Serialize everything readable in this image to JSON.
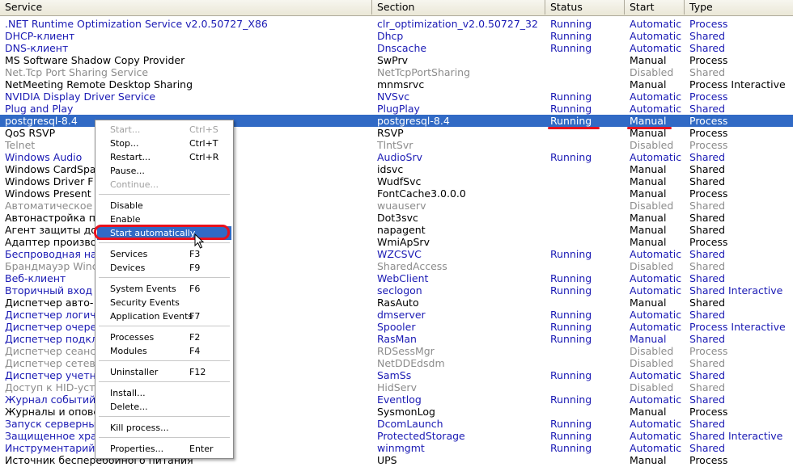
{
  "columns": [
    "Service",
    "Section",
    "Status",
    "Start",
    "Type"
  ],
  "rows": [
    {
      "service": ".NET Runtime Optimization Service v2.0.50727_X86",
      "section": "clr_optimization_v2.0.50727_32",
      "status": "Running",
      "start": "Automatic",
      "type": "Process",
      "style": "blue"
    },
    {
      "service": "DHCP-клиент",
      "section": "Dhcp",
      "status": "Running",
      "start": "Automatic",
      "type": "Shared",
      "style": "blue"
    },
    {
      "service": "DNS-клиент",
      "section": "Dnscache",
      "status": "Running",
      "start": "Automatic",
      "type": "Shared",
      "style": "blue"
    },
    {
      "service": "MS Software Shadow Copy Provider",
      "section": "SwPrv",
      "status": "",
      "start": "Manual",
      "type": "Process",
      "style": "black"
    },
    {
      "service": "Net.Tcp Port Sharing Service",
      "section": "NetTcpPortSharing",
      "status": "",
      "start": "Disabled",
      "type": "Shared",
      "style": "gray"
    },
    {
      "service": "NetMeeting Remote Desktop Sharing",
      "section": "mnmsrvc",
      "status": "",
      "start": "Manual",
      "type": "Process Interactive",
      "style": "black"
    },
    {
      "service": "NVIDIA Display Driver Service",
      "section": "NVSvc",
      "status": "Running",
      "start": "Automatic",
      "type": "Process",
      "style": "blue"
    },
    {
      "service": "Plug and Play",
      "section": "PlugPlay",
      "status": "Running",
      "start": "Automatic",
      "type": "Shared",
      "style": "blue"
    },
    {
      "service": "postgresql-8.4",
      "section": "postgresql-8.4",
      "status": "Running",
      "start": "Manual",
      "type": "Process",
      "style": "sel"
    },
    {
      "service": "QoS RSVP",
      "section": "RSVP",
      "status": "",
      "start": "Manual",
      "type": "Process",
      "style": "black"
    },
    {
      "service": "Telnet",
      "section": "TlntSvr",
      "status": "",
      "start": "Disabled",
      "type": "Process",
      "style": "gray"
    },
    {
      "service": "Windows Audio",
      "section": "AudioSrv",
      "status": "Running",
      "start": "Automatic",
      "type": "Shared",
      "style": "blue"
    },
    {
      "service": "Windows CardSpa",
      "section": "idsvc",
      "status": "",
      "start": "Manual",
      "type": "Shared",
      "style": "black"
    },
    {
      "service": "Windows Driver F                                   er Framework",
      "section": "WudfSvc",
      "status": "",
      "start": "Manual",
      "type": "Shared",
      "style": "black"
    },
    {
      "service": "Windows Present                                  e 3.0.0.0",
      "section": "FontCache3.0.0.0",
      "status": "",
      "start": "Manual",
      "type": "Process",
      "style": "black"
    },
    {
      "service": "Автоматическое",
      "section": "wuauserv",
      "status": "",
      "start": "Disabled",
      "type": "Shared",
      "style": "gray"
    },
    {
      "service": "Автонастройка п",
      "section": "Dot3svc",
      "status": "",
      "start": "Manual",
      "type": "Shared",
      "style": "black"
    },
    {
      "service": "Агент защиты до",
      "section": "napagent",
      "status": "",
      "start": "Manual",
      "type": "Shared",
      "style": "black"
    },
    {
      "service": "Адаптер произво",
      "section": "WmiApSrv",
      "status": "",
      "start": "Manual",
      "type": "Process",
      "style": "black"
    },
    {
      "service": "Беспроводная на",
      "section": "WZCSVC",
      "status": "Running",
      "start": "Automatic",
      "type": "Shared",
      "style": "blue"
    },
    {
      "service": "Брандмауэр Winc                                 рнету (ICS)",
      "section": "SharedAccess",
      "status": "",
      "start": "Disabled",
      "type": "Shared",
      "style": "gray"
    },
    {
      "service": "Веб-клиент",
      "section": "WebClient",
      "status": "Running",
      "start": "Automatic",
      "type": "Shared",
      "style": "blue"
    },
    {
      "service": "Вторичный вход",
      "section": "seclogon",
      "status": "Running",
      "start": "Automatic",
      "type": "Shared Interactive",
      "style": "blue"
    },
    {
      "service": "Диспетчер авто-                                  доступа",
      "section": "RasAuto",
      "status": "",
      "start": "Manual",
      "type": "Shared",
      "style": "black"
    },
    {
      "service": "Диспетчер логич",
      "section": "dmserver",
      "status": "Running",
      "start": "Automatic",
      "type": "Shared",
      "style": "blue"
    },
    {
      "service": "Диспетчер очере",
      "section": "Spooler",
      "status": "Running",
      "start": "Automatic",
      "type": "Process Interactive",
      "style": "blue"
    },
    {
      "service": "Диспетчер подкл                                  па",
      "section": "RasMan",
      "status": "Running",
      "start": "Manual",
      "type": "Shared",
      "style": "blue"
    },
    {
      "service": "Диспетчер сеанс                                 рабочего стола",
      "section": "RDSessMgr",
      "status": "",
      "start": "Disabled",
      "type": "Process",
      "style": "gray"
    },
    {
      "service": "Диспетчер сетев",
      "section": "NetDDEdsdm",
      "status": "",
      "start": "Disabled",
      "type": "Shared",
      "style": "gray"
    },
    {
      "service": "Диспетчер учетн",
      "section": "SamSs",
      "status": "Running",
      "start": "Automatic",
      "type": "Shared",
      "style": "blue"
    },
    {
      "service": "Доступ к HID-устр",
      "section": "HidServ",
      "status": "",
      "start": "Disabled",
      "type": "Shared",
      "style": "gray"
    },
    {
      "service": "Журнал событий",
      "section": "Eventlog",
      "status": "Running",
      "start": "Automatic",
      "type": "Shared",
      "style": "blue"
    },
    {
      "service": "Журналы и опове                                  ти",
      "section": "SysmonLog",
      "status": "",
      "start": "Manual",
      "type": "Process",
      "style": "black"
    },
    {
      "service": "Запуск серверны",
      "section": "DcomLaunch",
      "status": "Running",
      "start": "Automatic",
      "type": "Shared",
      "style": "blue"
    },
    {
      "service": "Защищенное хра",
      "section": "ProtectedStorage",
      "status": "Running",
      "start": "Automatic",
      "type": "Shared Interactive",
      "style": "blue"
    },
    {
      "service": "Инструментарий",
      "section": "winmgmt",
      "status": "Running",
      "start": "Automatic",
      "type": "Shared",
      "style": "blue"
    },
    {
      "service": "Источник бесперебойного питания",
      "section": "UPS",
      "status": "",
      "start": "Manual",
      "type": "Process",
      "style": "black"
    }
  ],
  "menu": {
    "items": [
      {
        "label": "Start...",
        "key": "Ctrl+S",
        "disabled": true
      },
      {
        "label": "Stop...",
        "key": "Ctrl+T"
      },
      {
        "label": "Restart...",
        "key": "Ctrl+R"
      },
      {
        "label": "Pause...",
        "key": ""
      },
      {
        "label": "Continue...",
        "key": "",
        "disabled": true
      },
      {
        "sep": true
      },
      {
        "label": "Disable",
        "key": ""
      },
      {
        "label": "Enable",
        "key": ""
      },
      {
        "label": "Start automatically",
        "key": "",
        "highlight": true
      },
      {
        "sep": true
      },
      {
        "label": "Services",
        "key": "F3"
      },
      {
        "label": "Devices",
        "key": "F9"
      },
      {
        "sep": true
      },
      {
        "label": "System Events",
        "key": "F6"
      },
      {
        "label": "Security Events",
        "key": ""
      },
      {
        "label": "Application Events",
        "key": "F7"
      },
      {
        "sep": true
      },
      {
        "label": "Processes",
        "key": "F2"
      },
      {
        "label": "Modules",
        "key": "F4"
      },
      {
        "sep": true
      },
      {
        "label": "Uninstaller",
        "key": "F12"
      },
      {
        "sep": true
      },
      {
        "label": "Install...",
        "key": ""
      },
      {
        "label": "Delete...",
        "key": ""
      },
      {
        "sep": true
      },
      {
        "label": "Kill process...",
        "key": ""
      },
      {
        "sep": true
      },
      {
        "label": "Properties...",
        "key": "Enter"
      }
    ]
  }
}
